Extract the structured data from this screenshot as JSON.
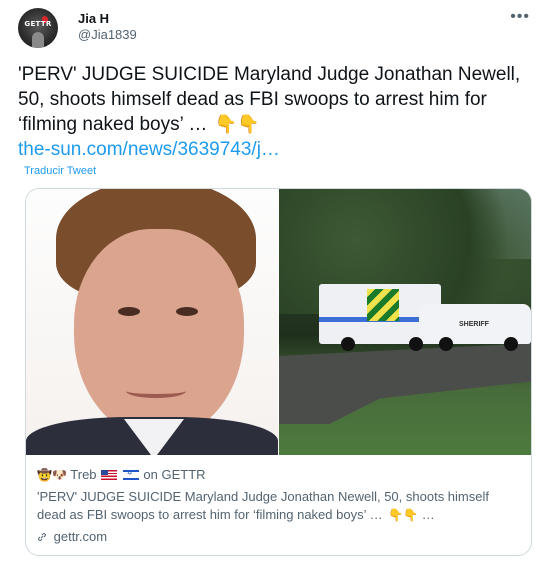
{
  "author": {
    "name": "Jia H",
    "handle": "@Jia1839",
    "avatar_text": "GETTR"
  },
  "more_icon": "more-horizontal-icon",
  "tweet": {
    "text": "'PERV' JUDGE SUICIDE Maryland Judge Jonathan Newell, 50, shoots himself dead as FBI swoops to arrest him for ‘filming naked boys’ …",
    "emojis": "👇👇",
    "link": "the-sun.com/news/3639743/j…",
    "translate_label": "Traducir Tweet"
  },
  "card": {
    "source_user": "Treb",
    "source_suffix": "on GETTR",
    "source_emojis": "🤠🐶",
    "description": "'PERV' JUDGE SUICIDE Maryland Judge Jonathan Newell, 50, shoots himself dead as FBI swoops to arrest him for ‘filming naked boys’ …",
    "desc_emojis": "👇👇",
    "desc_ellipsis": "…",
    "domain": "gettr.com",
    "vehicle_text": "SHERIFF"
  },
  "colors": {
    "link": "#1d9bf0",
    "secondary_text": "#536471",
    "border": "#cfd9de"
  }
}
